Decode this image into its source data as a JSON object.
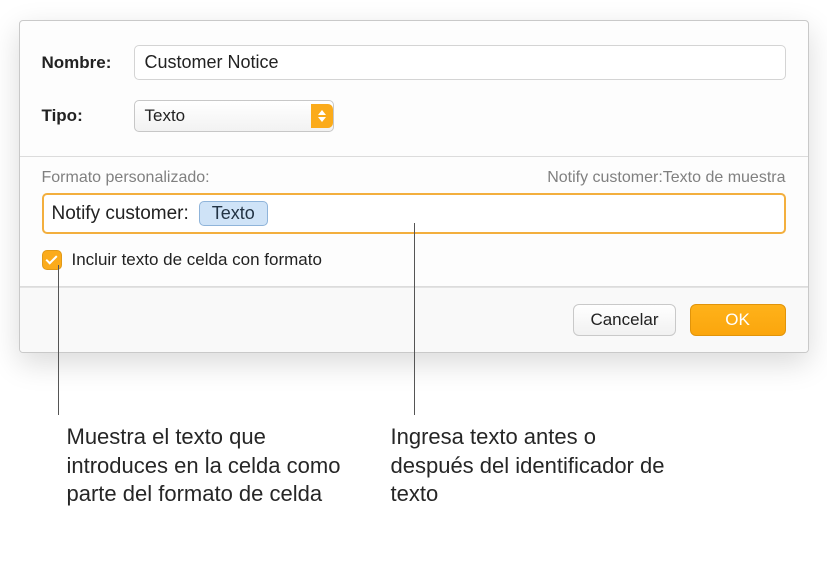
{
  "labels": {
    "name": "Nombre:",
    "type": "Tipo:",
    "custom_format": "Formato personalizado:",
    "checkbox": "Incluir texto de celda con formato"
  },
  "values": {
    "name": "Customer Notice",
    "type": "Texto",
    "preview": "Notify customer:Texto de muestra",
    "prefix": "Notify customer:",
    "token": "Texto"
  },
  "buttons": {
    "cancel": "Cancelar",
    "ok": "OK"
  },
  "callouts": {
    "left": "Muestra el texto que introduces en la celda como parte del formato de celda",
    "right": "Ingresa texto antes o después del identificador de texto"
  }
}
